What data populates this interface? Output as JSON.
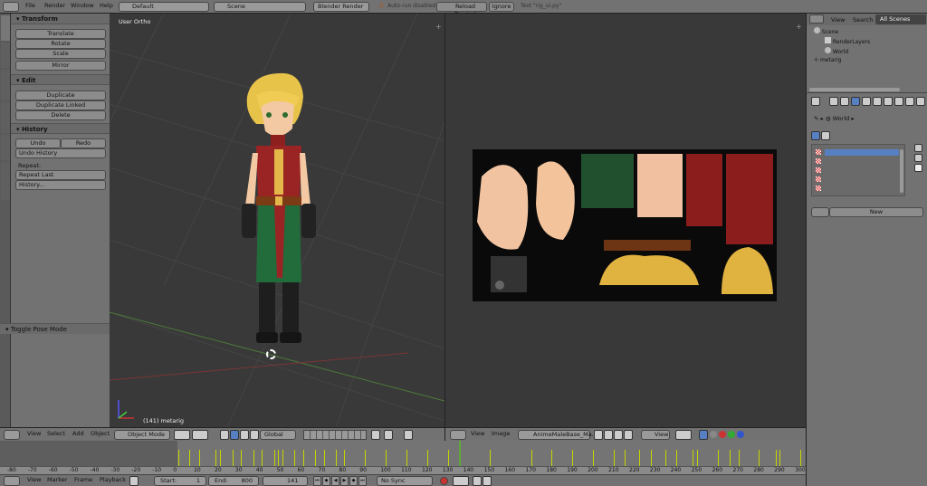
{
  "top_bar": {
    "menus": [
      "File",
      "Render",
      "Window",
      "Help"
    ],
    "screen_layout": "Default",
    "scene": "Scene",
    "engine": "Blender Render",
    "warning": "Auto-run disabled",
    "reload": "Reload Trusted",
    "ignore": "Ignore",
    "script_text": "Text \"rig_ui.py\""
  },
  "toolshelf": {
    "tabs": [
      "Tools",
      "Create",
      "Relations",
      "Animation",
      "Physics",
      "Grease Pencil"
    ],
    "transform": {
      "title": "Transform",
      "buttons": [
        "Translate",
        "Rotate",
        "Scale"
      ],
      "mirror": "Mirror"
    },
    "edit": {
      "title": "Edit",
      "buttons": [
        "Duplicate",
        "Duplicate Linked",
        "Delete"
      ]
    },
    "history": {
      "title": "History",
      "undo": "Undo",
      "redo": "Redo",
      "undo_history": "Undo History",
      "repeat_label": "Repeat:",
      "repeat_last": "Repeat Last",
      "history": "History..."
    },
    "operator": "Toggle Pose Mode"
  },
  "viewport": {
    "view_label": "User Ortho",
    "object_label": "(141) metarig",
    "header": {
      "menus": [
        "View",
        "Select",
        "Add",
        "Object"
      ],
      "mode": "Object Mode",
      "orientation": "Global"
    }
  },
  "image_editor": {
    "header": {
      "menus": [
        "View",
        "Image"
      ],
      "image_name": "AnimeMaleBase_Ma...",
      "view": "View"
    }
  },
  "outliner": {
    "tabs": [
      "View",
      "Search",
      "All Scenes"
    ],
    "items": [
      {
        "label": "Scene",
        "indent": 0
      },
      {
        "label": "RenderLayers",
        "indent": 1
      },
      {
        "label": "World",
        "indent": 1
      },
      {
        "label": "metarig",
        "indent": 0
      }
    ]
  },
  "properties": {
    "breadcrumb": "World",
    "new_button": "New"
  },
  "timeline": {
    "ruler_numbers": [
      "-80",
      "-70",
      "-60",
      "-50",
      "-40",
      "-30",
      "-20",
      "-10",
      "0",
      "10",
      "20",
      "30",
      "40",
      "50",
      "60",
      "70",
      "80",
      "90",
      "100",
      "110",
      "120",
      "130",
      "140",
      "150",
      "160",
      "170",
      "180",
      "190",
      "200",
      "210",
      "220",
      "230",
      "240",
      "250",
      "260",
      "270",
      "280",
      "290",
      "300"
    ],
    "current_frame": 141,
    "footer": {
      "menus": [
        "View",
        "Marker",
        "Frame",
        "Playback"
      ],
      "start_label": "Start:",
      "start": "1",
      "end_label": "End:",
      "end": "800",
      "current": "141",
      "sync": "No Sync"
    }
  },
  "colors": {
    "accent": "#5680c2",
    "keyframe": "#c7d400",
    "current_frame": "#5fa83a",
    "viewport_bg": "#393939"
  }
}
